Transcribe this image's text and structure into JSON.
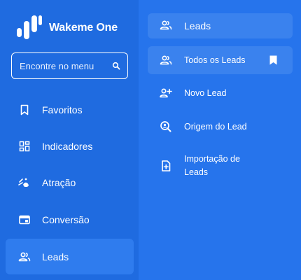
{
  "app": {
    "name": "Wakeme One"
  },
  "search": {
    "placeholder": "Encontre no menu"
  },
  "sidebar": {
    "items": [
      {
        "label": "Favoritos",
        "icon": "bookmark-icon"
      },
      {
        "label": "Indicadores",
        "icon": "dashboard-icon"
      },
      {
        "label": "Atração",
        "icon": "attraction-icon"
      },
      {
        "label": "Conversão",
        "icon": "conversion-icon"
      },
      {
        "label": "Leads",
        "icon": "users-icon",
        "active": true
      }
    ]
  },
  "submenu": {
    "title": "Leads",
    "items": [
      {
        "label": "Todos os Leads",
        "icon": "users-icon",
        "active": true,
        "favorite": true
      },
      {
        "label": "Novo Lead",
        "icon": "add-user-icon"
      },
      {
        "label": "Origem do Lead",
        "icon": "origin-search-icon"
      },
      {
        "label_line1": "Importação de",
        "label_line2": "Leads",
        "icon": "import-icon"
      }
    ]
  },
  "colors": {
    "background": "#2270E8",
    "left_panel": "#1F6BE0",
    "right_panel": "#2674EC",
    "active": "#2F7CEE",
    "sub_active": "#3A82EE",
    "text": "#FFFFFF"
  }
}
